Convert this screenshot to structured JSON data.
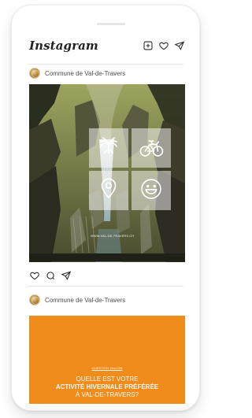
{
  "app": {
    "brand": "Instagram",
    "header_icons": [
      "new-post-icon",
      "heart-icon",
      "send-icon"
    ]
  },
  "posts": [
    {
      "account_name": "Commune de Val-de-Travers",
      "image": {
        "url_text": "WWW.VAL-DE-TRAVERS.CH",
        "tile_icons": [
          "absinthe-flower-icon",
          "bicycle-icon",
          "location-pin-icon",
          "smiley-icon"
        ]
      },
      "actions": [
        "heart-icon",
        "comment-icon",
        "send-icon"
      ]
    },
    {
      "account_name": "Commune de Val-de-Travers",
      "image": {
        "label": "QUESTION VALLON",
        "line1": "QUELLE EST VOTRE",
        "line2": "ACTIVITÉ HIVERNALE PRÉFÉRÉE",
        "line3": "À VAL-DE-TRAVERS?",
        "background_color": "#f08c1c"
      }
    }
  ]
}
